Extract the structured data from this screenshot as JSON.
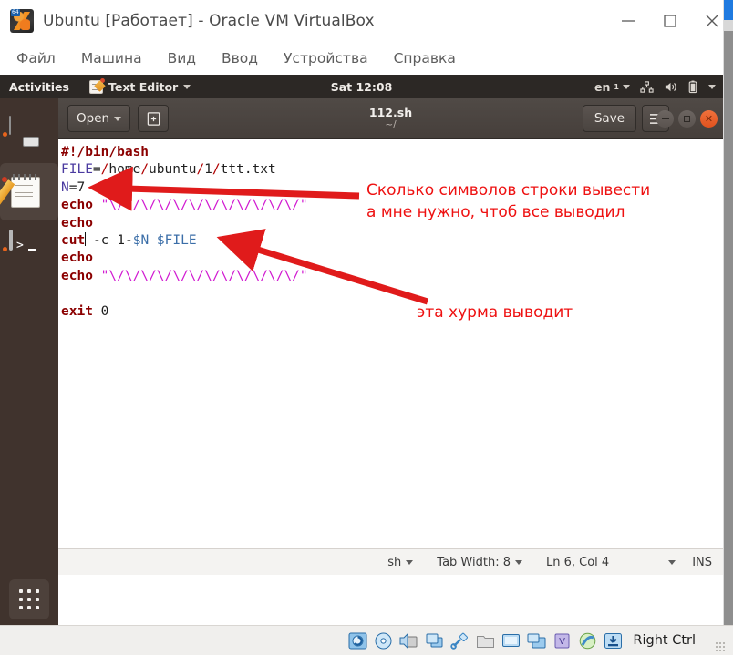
{
  "host_window": {
    "title": "Ubuntu [Работает] - Oracle VM VirtualBox",
    "icon": "virtualbox-icon",
    "badge": "64",
    "controls": {
      "minimize": "minimize-button",
      "maximize": "maximize-button",
      "close": "close-button"
    },
    "menu": [
      {
        "label": "Файл"
      },
      {
        "label": "Машина"
      },
      {
        "label": "Вид"
      },
      {
        "label": "Ввод"
      },
      {
        "label": "Устройства"
      },
      {
        "label": "Справка"
      }
    ]
  },
  "gnome_topbar": {
    "activities": "Activities",
    "app_name": "Text Editor",
    "clock": "Sat 12:08",
    "keyboard": "en",
    "keyboard_sub": "1",
    "tray": [
      "network-icon",
      "volume-icon",
      "battery-icon",
      "system-menu-caret"
    ]
  },
  "dock": {
    "items": [
      {
        "name": "files",
        "label": "Files",
        "running": true,
        "active": false
      },
      {
        "name": "text-editor",
        "label": "Text Editor",
        "running": true,
        "active": true
      },
      {
        "name": "terminal",
        "label": "Terminal",
        "running": true,
        "active": false
      }
    ],
    "show_applications": "Show Applications",
    "tooltip": "Show Applications"
  },
  "editor": {
    "header": {
      "open_label": "Open",
      "save_label": "Save",
      "title": "112.sh",
      "subtitle": "~/",
      "new_tab_icon": "new-document-icon",
      "menu_icon": "hamburger-menu-icon"
    },
    "code_lines": [
      "#!/bin/bash",
      "FILE=/home/ubuntu/1/ttt.txt",
      "N=7",
      "echo \"\\/\\/\\/\\/\\/\\/\\/\\/\\/\\/\\/\\/\"",
      "echo",
      "cut -c 1-$N $FILE",
      "echo",
      "echo \"\\/\\/\\/\\/\\/\\/\\/\\/\\/\\/\\/\\/\"",
      "",
      "exit 0"
    ],
    "annotations": [
      {
        "id": "ann-1",
        "line1": "Сколько символов строки вывести",
        "line2": "а мне нужно, чтоб все выводил",
        "color": "#ee1111"
      },
      {
        "id": "ann-2",
        "line1": "эта хурма выводит",
        "color": "#ee1111"
      }
    ],
    "status": {
      "language": "sh",
      "tab_width": "Tab Width: 8",
      "position": "Ln 6, Col 4",
      "insert_mode": "INS"
    }
  },
  "vbox_status": {
    "icons": [
      "hard-disk-icon",
      "optical-disk-icon",
      "audio-icon",
      "network-icon",
      "usb-icon",
      "shared-folders-icon",
      "display-icon",
      "recording-icon",
      "processor-icon",
      "guest-additions-icon",
      "download-icon"
    ],
    "host_key": "Right Ctrl"
  },
  "colors": {
    "accent_orange": "#e8641c",
    "annotation_red": "#ee1111",
    "string_magenta": "#d119d1",
    "keyword_darkred": "#8b0000",
    "variable_blue": "#3b6ea8",
    "header_dark": "#4a4440",
    "dock_bg": "#3a2c26"
  }
}
